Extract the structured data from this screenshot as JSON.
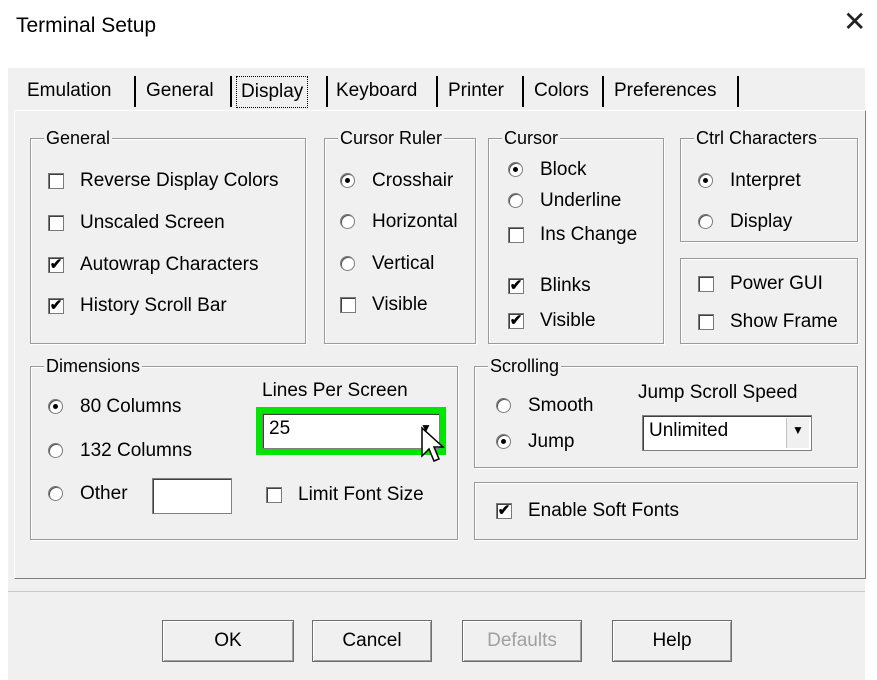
{
  "window": {
    "title": "Terminal Setup",
    "close_glyph": "✕"
  },
  "tabs": [
    "Emulation",
    "General",
    "Display",
    "Keyboard",
    "Printer",
    "Colors",
    "Preferences"
  ],
  "active_tab": "Display",
  "general": {
    "legend": "General",
    "items": [
      {
        "label": "Reverse Display Colors",
        "checked": false
      },
      {
        "label": "Unscaled Screen",
        "checked": false
      },
      {
        "label": "Autowrap Characters",
        "checked": true
      },
      {
        "label": "History Scroll Bar",
        "checked": true
      }
    ]
  },
  "cursor_ruler": {
    "legend": "Cursor Ruler",
    "options": [
      {
        "label": "Crosshair",
        "selected": true
      },
      {
        "label": "Horizontal",
        "selected": false
      },
      {
        "label": "Vertical",
        "selected": false
      }
    ],
    "visible": {
      "label": "Visible",
      "checked": false
    }
  },
  "cursor": {
    "legend": "Cursor",
    "options": [
      {
        "label": "Block",
        "selected": true
      },
      {
        "label": "Underline",
        "selected": false
      }
    ],
    "ins_change": {
      "label": "Ins Change",
      "checked": false
    },
    "blinks": {
      "label": "Blinks",
      "checked": true
    },
    "visible": {
      "label": "Visible",
      "checked": true
    }
  },
  "ctrl_characters": {
    "legend": "Ctrl Characters",
    "options": [
      {
        "label": "Interpret",
        "selected": true
      },
      {
        "label": "Display",
        "selected": false
      }
    ]
  },
  "gui": {
    "power_gui": {
      "label": "Power GUI",
      "checked": false
    },
    "show_frame": {
      "label": "Show Frame",
      "checked": false
    }
  },
  "dimensions": {
    "legend": "Dimensions",
    "options": [
      {
        "label": "80 Columns",
        "selected": true
      },
      {
        "label": "132 Columns",
        "selected": false
      },
      {
        "label": "Other",
        "selected": false
      }
    ],
    "other_value": "",
    "lines_label": "Lines Per Screen",
    "lines_value": "25",
    "limit_font": {
      "label": "Limit Font Size",
      "checked": false
    }
  },
  "scrolling": {
    "legend": "Scrolling",
    "options": [
      {
        "label": "Smooth",
        "selected": false
      },
      {
        "label": "Jump",
        "selected": true
      }
    ],
    "speed_label": "Jump Scroll Speed",
    "speed_value": "Unlimited"
  },
  "soft_fonts": {
    "label": "Enable Soft Fonts",
    "checked": true
  },
  "buttons": {
    "ok": "OK",
    "cancel": "Cancel",
    "defaults": "Defaults",
    "help": "Help"
  },
  "colors": {
    "highlight": "#00e600"
  },
  "glyphs": {
    "check": "✔",
    "dropdown": "▼"
  }
}
